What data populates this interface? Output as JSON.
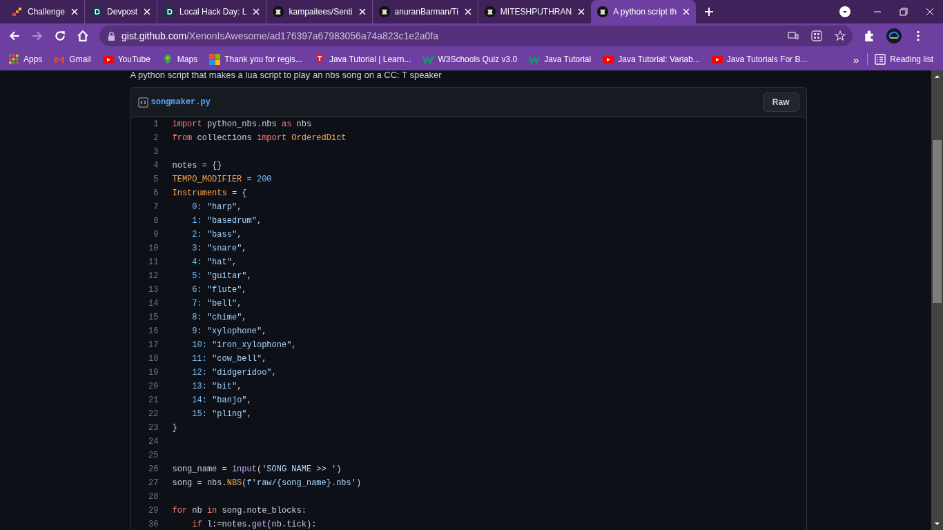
{
  "tabs": [
    {
      "title": "Challenge",
      "kind": "challenge",
      "selected": false
    },
    {
      "title": "Devpost",
      "kind": "devpost",
      "selected": false
    },
    {
      "title": "Local Hack Day: L",
      "kind": "devpost",
      "selected": false
    },
    {
      "title": "kampaitees/Senti",
      "kind": "github",
      "selected": false
    },
    {
      "title": "anuranBarman/Ti",
      "kind": "github",
      "selected": false
    },
    {
      "title": "MITESHPUTHRAN",
      "kind": "github",
      "selected": false
    },
    {
      "title": "A python script th",
      "kind": "github",
      "selected": true
    }
  ],
  "address": {
    "host": "gist.github.com",
    "path": "/XenonIsAwesome/ad176397a67983056a74a823c1e2a0fa"
  },
  "bookmarks": [
    {
      "label": "Apps",
      "kind": "apps"
    },
    {
      "label": "Gmail",
      "kind": "gmail"
    },
    {
      "label": "YouTube",
      "kind": "youtube"
    },
    {
      "label": "Maps",
      "kind": "maps"
    },
    {
      "label": "Thank you for regis...",
      "kind": "windows"
    },
    {
      "label": "Java Tutorial | Learn...",
      "kind": "tutorial"
    },
    {
      "label": "W3Schools Quiz v3.0",
      "kind": "w3"
    },
    {
      "label": "Java Tutorial",
      "kind": "w3"
    },
    {
      "label": "Java Tutorial: Variab...",
      "kind": "youtube"
    },
    {
      "label": "Java Tutorials For B...",
      "kind": "youtube"
    }
  ],
  "bookmarks_more": "»",
  "reading_list": "Reading list",
  "description": "A python script that makes a lua script to play an nbs song on a CC: T speaker",
  "file": {
    "name": "songmaker.py",
    "raw_button": "Raw"
  },
  "code": [
    {
      "number": "1",
      "tokens": [
        {
          "kind": "kw",
          "text": "import"
        },
        {
          "kind": "plain",
          "text": " python_nbs.nbs "
        },
        {
          "kind": "kw",
          "text": "as"
        },
        {
          "kind": "plain",
          "text": " nbs"
        }
      ]
    },
    {
      "number": "2",
      "tokens": [
        {
          "kind": "kw",
          "text": "from"
        },
        {
          "kind": "plain",
          "text": " collections "
        },
        {
          "kind": "kw",
          "text": "import"
        },
        {
          "kind": "const",
          "text": " OrderedDict"
        }
      ]
    },
    {
      "number": "3"
    },
    {
      "number": "4",
      "tokens": [
        {
          "kind": "plain",
          "text": "notes = {}"
        }
      ]
    },
    {
      "number": "5",
      "tokens": [
        {
          "kind": "const",
          "text": "TEMPO_MODIFIER"
        },
        {
          "kind": "plain",
          "text": " = "
        },
        {
          "kind": "num",
          "text": "200"
        }
      ]
    },
    {
      "number": "6",
      "tokens": [
        {
          "kind": "const",
          "text": "Instruments"
        },
        {
          "kind": "plain",
          "text": " = {"
        }
      ]
    },
    {
      "number": "7",
      "tokens": [
        {
          "kind": "num",
          "text": "    0:"
        },
        {
          "kind": "str",
          "text": " \"harp\""
        },
        {
          "kind": "plain",
          "text": ","
        }
      ]
    },
    {
      "number": "8",
      "tokens": [
        {
          "kind": "num",
          "text": "    1:"
        },
        {
          "kind": "str",
          "text": " \"basedrum\""
        },
        {
          "kind": "plain",
          "text": ","
        }
      ]
    },
    {
      "number": "9",
      "tokens": [
        {
          "kind": "num",
          "text": "    2:"
        },
        {
          "kind": "str",
          "text": " \"bass\""
        },
        {
          "kind": "plain",
          "text": ","
        }
      ]
    },
    {
      "number": "10",
      "tokens": [
        {
          "kind": "num",
          "text": "    3:"
        },
        {
          "kind": "str",
          "text": " \"snare\""
        },
        {
          "kind": "plain",
          "text": ","
        }
      ]
    },
    {
      "number": "11",
      "tokens": [
        {
          "kind": "num",
          "text": "    4:"
        },
        {
          "kind": "str",
          "text": " \"hat\""
        },
        {
          "kind": "plain",
          "text": ","
        }
      ]
    },
    {
      "number": "12",
      "tokens": [
        {
          "kind": "num",
          "text": "    5:"
        },
        {
          "kind": "str",
          "text": " \"guitar\""
        },
        {
          "kind": "plain",
          "text": ","
        }
      ]
    },
    {
      "number": "13",
      "tokens": [
        {
          "kind": "num",
          "text": "    6:"
        },
        {
          "kind": "str",
          "text": " \"flute\""
        },
        {
          "kind": "plain",
          "text": ","
        }
      ]
    },
    {
      "number": "14",
      "tokens": [
        {
          "kind": "num",
          "text": "    7:"
        },
        {
          "kind": "str",
          "text": " \"bell\""
        },
        {
          "kind": "plain",
          "text": ","
        }
      ]
    },
    {
      "number": "15",
      "tokens": [
        {
          "kind": "num",
          "text": "    8:"
        },
        {
          "kind": "str",
          "text": " \"chime\""
        },
        {
          "kind": "plain",
          "text": ","
        }
      ]
    },
    {
      "number": "16",
      "tokens": [
        {
          "kind": "num",
          "text": "    9:"
        },
        {
          "kind": "str",
          "text": " \"xylophone\""
        },
        {
          "kind": "plain",
          "text": ","
        }
      ]
    },
    {
      "number": "17",
      "tokens": [
        {
          "kind": "num",
          "text": "    10:"
        },
        {
          "kind": "str",
          "text": " \"iron_xylophone\""
        },
        {
          "kind": "plain",
          "text": ","
        }
      ]
    },
    {
      "number": "18",
      "tokens": [
        {
          "kind": "num",
          "text": "    11:"
        },
        {
          "kind": "str",
          "text": " \"cow_bell\""
        },
        {
          "kind": "plain",
          "text": ","
        }
      ]
    },
    {
      "number": "19",
      "tokens": [
        {
          "kind": "num",
          "text": "    12:"
        },
        {
          "kind": "str",
          "text": " \"didgeridoo\""
        },
        {
          "kind": "plain",
          "text": ","
        }
      ]
    },
    {
      "number": "20",
      "tokens": [
        {
          "kind": "num",
          "text": "    13:"
        },
        {
          "kind": "str",
          "text": " \"bit\""
        },
        {
          "kind": "plain",
          "text": ","
        }
      ]
    },
    {
      "number": "21",
      "tokens": [
        {
          "kind": "num",
          "text": "    14:"
        },
        {
          "kind": "str",
          "text": " \"banjo\""
        },
        {
          "kind": "plain",
          "text": ","
        }
      ]
    },
    {
      "number": "22",
      "tokens": [
        {
          "kind": "num",
          "text": "    15:"
        },
        {
          "kind": "str",
          "text": " \"pling\""
        },
        {
          "kind": "plain",
          "text": ","
        }
      ]
    },
    {
      "number": "23",
      "tokens": [
        {
          "kind": "plain",
          "text": "}"
        }
      ]
    },
    {
      "number": "24"
    },
    {
      "number": "25"
    },
    {
      "number": "26",
      "tokens": [
        {
          "kind": "plain",
          "text": "song_name = "
        },
        {
          "kind": "fn",
          "text": "input"
        },
        {
          "kind": "plain",
          "text": "("
        },
        {
          "kind": "str",
          "text": "'SONG NAME >> '"
        },
        {
          "kind": "plain",
          "text": ")"
        }
      ]
    },
    {
      "number": "27",
      "tokens": [
        {
          "kind": "plain",
          "text": "song = nbs."
        },
        {
          "kind": "const",
          "text": "NBS"
        },
        {
          "kind": "plain",
          "text": "("
        },
        {
          "kind": "str",
          "text": "f'raw/{song_name}.nbs'"
        },
        {
          "kind": "plain",
          "text": ")"
        }
      ]
    },
    {
      "number": "28"
    },
    {
      "number": "29",
      "tokens": [
        {
          "kind": "kw",
          "text": "for"
        },
        {
          "kind": "plain",
          "text": " nb "
        },
        {
          "kind": "kw",
          "text": "in"
        },
        {
          "kind": "plain",
          "text": " song.note_blocks:"
        }
      ]
    },
    {
      "number": "30",
      "tokens": [
        {
          "kind": "kw",
          "text": "    if"
        },
        {
          "kind": "plain",
          "text": " l:=notes."
        },
        {
          "kind": "fn",
          "text": "get"
        },
        {
          "kind": "plain",
          "text": "(nb.tick):"
        }
      ]
    }
  ]
}
